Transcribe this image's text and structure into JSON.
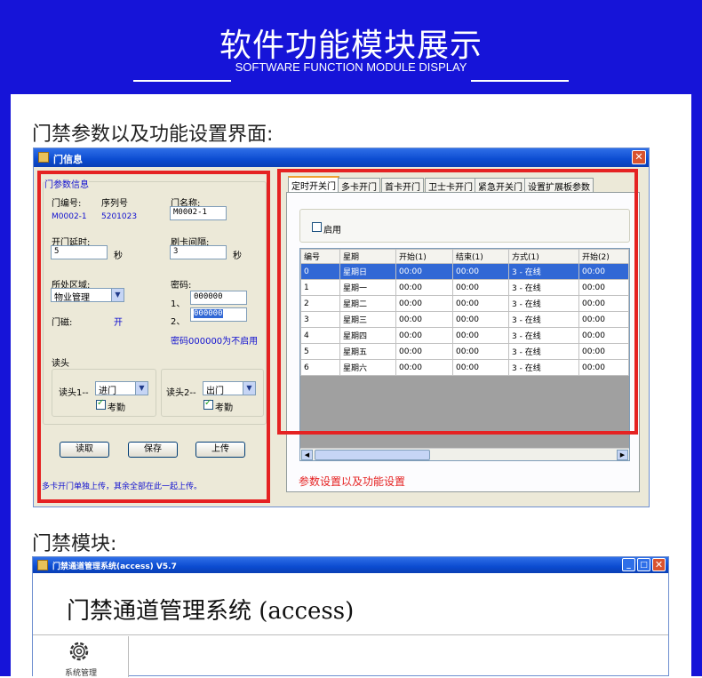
{
  "header": {
    "title": "软件功能模块展示",
    "subtitle": "SOFTWARE FUNCTION MODULE DISPLAY"
  },
  "section1": {
    "title": "门禁参数以及功能设置界面:"
  },
  "door_window": {
    "title": "门信息",
    "close": "✕",
    "group_title": "门参数信息",
    "door_no_label": "门编号:",
    "serial_label": "序列号",
    "door_no_value": "M0002-1",
    "serial_value": "5201023",
    "door_name_label": "门名称:",
    "door_name_value": "M0002-1",
    "delay_label": "开门延时:",
    "delay_value": "5",
    "delay_unit": "秒",
    "interval_label": "刷卡间隔:",
    "interval_value": "3",
    "interval_unit": "秒",
    "area_label": "所处区域:",
    "area_value": "物业管理",
    "password_label": "密码:",
    "pw1_prefix": "1、",
    "pw1_value": "000000",
    "pw2_prefix": "2、",
    "pw2_value": "000000",
    "sensor_label": "门磁:",
    "sensor_value": "开",
    "password_note": "密码000000为不启用",
    "reader_group": "读头",
    "reader1_label": "读头1--",
    "reader1_value": "进门",
    "reader2_label": "读头2--",
    "reader2_value": "出门",
    "attendance1": "考勤",
    "attendance2": "考勤",
    "btn_read": "读取",
    "btn_save": "保存",
    "btn_upload": "上传",
    "footer_note": "多卡开门单独上传，其余全部在此一起上传。",
    "tabs": [
      "定时开关门",
      "多卡开门",
      "首卡开门",
      "卫士卡开门",
      "紧急开关门",
      "设置扩展板参数"
    ],
    "enable_label": "启用",
    "table": {
      "columns": [
        "编号",
        "星期",
        "开始(1)",
        "结束(1)",
        "方式(1)",
        "开始(2)"
      ],
      "rows": [
        [
          "0",
          "星期日",
          "00:00",
          "00:00",
          "3 - 在线",
          "00:00"
        ],
        [
          "1",
          "星期一",
          "00:00",
          "00:00",
          "3 - 在线",
          "00:00"
        ],
        [
          "2",
          "星期二",
          "00:00",
          "00:00",
          "3 - 在线",
          "00:00"
        ],
        [
          "3",
          "星期三",
          "00:00",
          "00:00",
          "3 - 在线",
          "00:00"
        ],
        [
          "4",
          "星期四",
          "00:00",
          "00:00",
          "3 - 在线",
          "00:00"
        ],
        [
          "5",
          "星期五",
          "00:00",
          "00:00",
          "3 - 在线",
          "00:00"
        ],
        [
          "6",
          "星期六",
          "00:00",
          "00:00",
          "3 - 在线",
          "00:00"
        ]
      ]
    },
    "caption": "参数设置以及功能设置"
  },
  "section2": {
    "title": "门禁模块:"
  },
  "access_window": {
    "title": "门禁通道管理系统(access) V5.7",
    "heading": "门禁通道管理系统 (access)",
    "sidebar_item": "系统管理"
  },
  "colors": {
    "frame_blue": "#1614d8",
    "highlight_red": "#e52222",
    "selection_blue": "#3168d5"
  }
}
